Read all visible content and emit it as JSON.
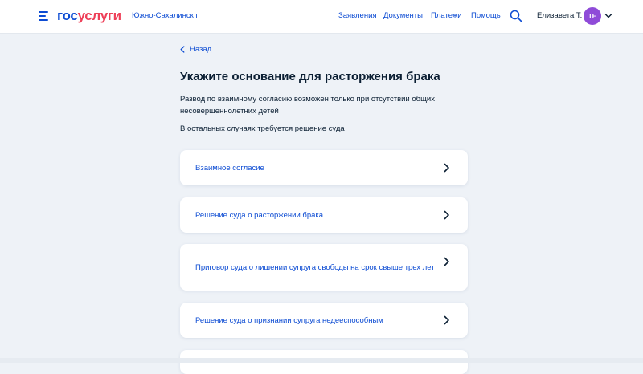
{
  "header": {
    "logo_part1": "гос",
    "logo_part2": "услуги",
    "city": "Южно-Сахалинск г",
    "nav": [
      {
        "label": "Заявления"
      },
      {
        "label": "Документы"
      },
      {
        "label": "Платежи"
      },
      {
        "label": "Помощь"
      }
    ],
    "user_name": "Елизавета Т.",
    "avatar_initials": "ТЕ"
  },
  "page": {
    "back_label": "Назад",
    "title": "Укажите основание для расторжения брака",
    "description": "Развод по взаимному согласию возможен только при отсутствии общих несовершеннолетних детей",
    "note": "В остальных случаях требуется решение суда",
    "options": [
      {
        "label": "Взаимное согласие"
      },
      {
        "label": "Решение суда о расторжении брака"
      },
      {
        "label": "Приговор суда о лишении супруга свободы на срок свыше трех лет"
      },
      {
        "label": "Решение суда о признании супруга недееспособным"
      }
    ]
  },
  "colors": {
    "brand_blue": "#0d4cd3",
    "brand_red": "#ee3f58",
    "background": "#eef2f7",
    "avatar": "#8f4bd8"
  },
  "icons": [
    "menu-icon",
    "search-icon",
    "chevron-down-icon",
    "chevron-left-icon",
    "chevron-right-icon"
  ]
}
